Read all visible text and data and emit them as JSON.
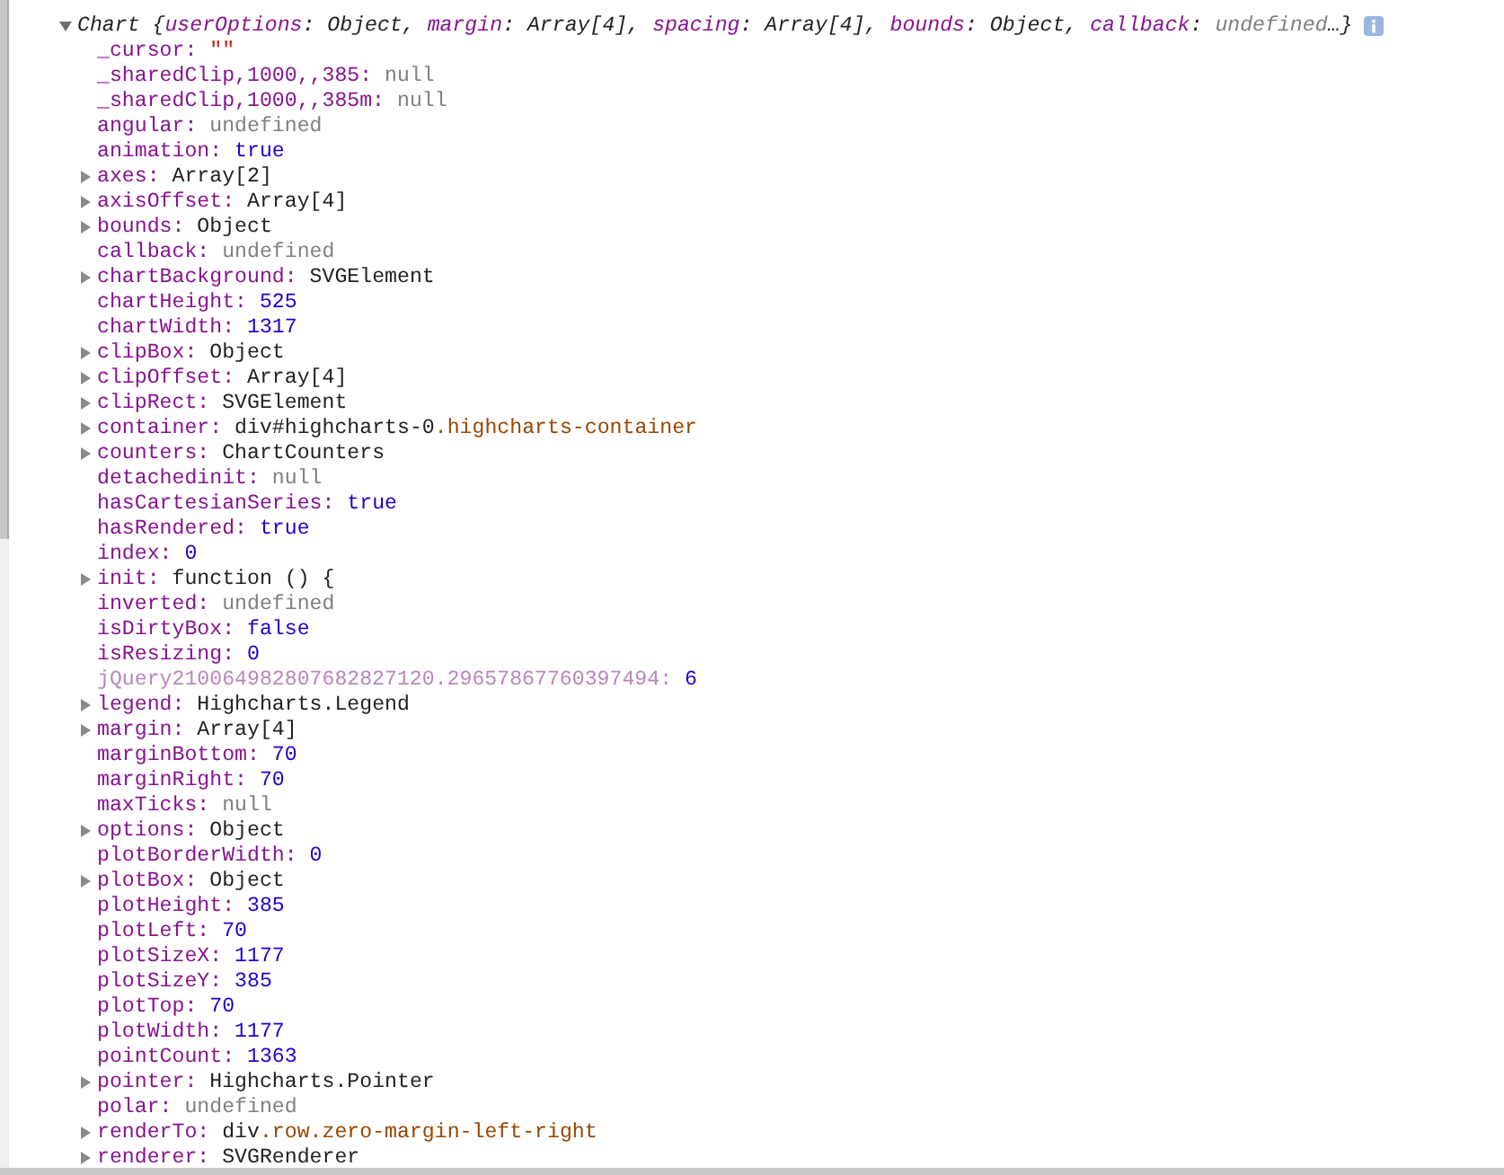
{
  "object": {
    "expanded": true,
    "summary": [
      {
        "text": "Chart {",
        "kind": "plain"
      },
      {
        "text": "userOptions",
        "kind": "key"
      },
      {
        "text": ": Object, ",
        "kind": "plain"
      },
      {
        "text": "margin",
        "kind": "key"
      },
      {
        "text": ": Array[4], ",
        "kind": "plain"
      },
      {
        "text": "spacing",
        "kind": "key"
      },
      {
        "text": ": Array[4], ",
        "kind": "plain"
      },
      {
        "text": "bounds",
        "kind": "key"
      },
      {
        "text": ": Object, ",
        "kind": "plain"
      },
      {
        "text": "callback",
        "kind": "key"
      },
      {
        "text": ": ",
        "kind": "plain"
      },
      {
        "text": "undefined",
        "kind": "null"
      },
      {
        "text": "…}",
        "kind": "plain"
      }
    ],
    "properties": [
      {
        "key": "_cursor:",
        "value": "\"\"",
        "kind": "string",
        "expandable": false,
        "dimmed": false
      },
      {
        "key": "_sharedClip,1000,,385:",
        "value": "null",
        "kind": "null",
        "expandable": false,
        "dimmed": false
      },
      {
        "key": "_sharedClip,1000,,385m:",
        "value": "null",
        "kind": "null",
        "expandable": false,
        "dimmed": false
      },
      {
        "key": "angular:",
        "value": "undefined",
        "kind": "null",
        "expandable": false,
        "dimmed": false
      },
      {
        "key": "animation:",
        "value": "true",
        "kind": "number",
        "expandable": false,
        "dimmed": false
      },
      {
        "key": "axes:",
        "value": "Array[2]",
        "kind": "object",
        "expandable": true,
        "dimmed": false
      },
      {
        "key": "axisOffset:",
        "value": "Array[4]",
        "kind": "object",
        "expandable": true,
        "dimmed": false
      },
      {
        "key": "bounds:",
        "value": "Object",
        "kind": "object",
        "expandable": true,
        "dimmed": false
      },
      {
        "key": "callback:",
        "value": "undefined",
        "kind": "null",
        "expandable": false,
        "dimmed": false
      },
      {
        "key": "chartBackground:",
        "value": "SVGElement",
        "kind": "object",
        "expandable": true,
        "dimmed": false
      },
      {
        "key": "chartHeight:",
        "value": "525",
        "kind": "number",
        "expandable": false,
        "dimmed": false
      },
      {
        "key": "chartWidth:",
        "value": "1317",
        "kind": "number",
        "expandable": false,
        "dimmed": false
      },
      {
        "key": "clipBox:",
        "value": "Object",
        "kind": "object",
        "expandable": true,
        "dimmed": false
      },
      {
        "key": "clipOffset:",
        "value": "Array[4]",
        "kind": "object",
        "expandable": true,
        "dimmed": false
      },
      {
        "key": "clipRect:",
        "value": "SVGElement",
        "kind": "object",
        "expandable": true,
        "dimmed": false
      },
      {
        "key": "container:",
        "value": "div#highcharts-0",
        "value_class": ".highcharts-container",
        "kind": "object",
        "expandable": true,
        "dimmed": false
      },
      {
        "key": "counters:",
        "value": "ChartCounters",
        "kind": "object",
        "expandable": true,
        "dimmed": false
      },
      {
        "key": "detachedinit:",
        "value": "null",
        "kind": "null",
        "expandable": false,
        "dimmed": false
      },
      {
        "key": "hasCartesianSeries:",
        "value": "true",
        "kind": "number",
        "expandable": false,
        "dimmed": false
      },
      {
        "key": "hasRendered:",
        "value": "true",
        "kind": "number",
        "expandable": false,
        "dimmed": false
      },
      {
        "key": "index:",
        "value": "0",
        "kind": "number",
        "expandable": false,
        "dimmed": false
      },
      {
        "key": "init:",
        "value": "function () {",
        "kind": "object",
        "expandable": true,
        "dimmed": false
      },
      {
        "key": "inverted:",
        "value": "undefined",
        "kind": "null",
        "expandable": false,
        "dimmed": false
      },
      {
        "key": "isDirtyBox:",
        "value": "false",
        "kind": "number",
        "expandable": false,
        "dimmed": false
      },
      {
        "key": "isResizing:",
        "value": "0",
        "kind": "number",
        "expandable": false,
        "dimmed": false
      },
      {
        "key": "jQuery210064982807682827120.29657867760397494:",
        "value": "6",
        "kind": "number",
        "expandable": false,
        "dimmed": true
      },
      {
        "key": "legend:",
        "value": "Highcharts.Legend",
        "kind": "object",
        "expandable": true,
        "dimmed": false
      },
      {
        "key": "margin:",
        "value": "Array[4]",
        "kind": "object",
        "expandable": true,
        "dimmed": false
      },
      {
        "key": "marginBottom:",
        "value": "70",
        "kind": "number",
        "expandable": false,
        "dimmed": false
      },
      {
        "key": "marginRight:",
        "value": "70",
        "kind": "number",
        "expandable": false,
        "dimmed": false
      },
      {
        "key": "maxTicks:",
        "value": "null",
        "kind": "null",
        "expandable": false,
        "dimmed": false
      },
      {
        "key": "options:",
        "value": "Object",
        "kind": "object",
        "expandable": true,
        "dimmed": false
      },
      {
        "key": "plotBorderWidth:",
        "value": "0",
        "kind": "number",
        "expandable": false,
        "dimmed": false
      },
      {
        "key": "plotBox:",
        "value": "Object",
        "kind": "object",
        "expandable": true,
        "dimmed": false
      },
      {
        "key": "plotHeight:",
        "value": "385",
        "kind": "number",
        "expandable": false,
        "dimmed": false
      },
      {
        "key": "plotLeft:",
        "value": "70",
        "kind": "number",
        "expandable": false,
        "dimmed": false
      },
      {
        "key": "plotSizeX:",
        "value": "1177",
        "kind": "number",
        "expandable": false,
        "dimmed": false
      },
      {
        "key": "plotSizeY:",
        "value": "385",
        "kind": "number",
        "expandable": false,
        "dimmed": false
      },
      {
        "key": "plotTop:",
        "value": "70",
        "kind": "number",
        "expandable": false,
        "dimmed": false
      },
      {
        "key": "plotWidth:",
        "value": "1177",
        "kind": "number",
        "expandable": false,
        "dimmed": false
      },
      {
        "key": "pointCount:",
        "value": "1363",
        "kind": "number",
        "expandable": false,
        "dimmed": false
      },
      {
        "key": "pointer:",
        "value": "Highcharts.Pointer",
        "kind": "object",
        "expandable": true,
        "dimmed": false
      },
      {
        "key": "polar:",
        "value": "undefined",
        "kind": "null",
        "expandable": false,
        "dimmed": false
      },
      {
        "key": "renderTo:",
        "value": "div",
        "value_class": ".row.zero-margin-left-right",
        "kind": "object",
        "expandable": true,
        "dimmed": false
      },
      {
        "key": "renderer:",
        "value": "SVGRenderer",
        "kind": "object",
        "expandable": true,
        "dimmed": false
      }
    ]
  }
}
